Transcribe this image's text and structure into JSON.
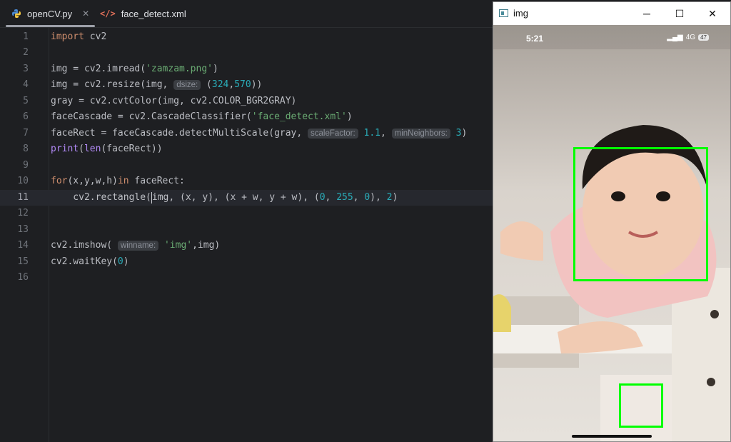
{
  "tabs": [
    {
      "label": "openCV.py",
      "active": true
    },
    {
      "label": "face_detect.xml",
      "active": false
    }
  ],
  "code_lines": [
    {
      "n": "1"
    },
    {
      "n": "2"
    },
    {
      "n": "3"
    },
    {
      "n": "4"
    },
    {
      "n": "5"
    },
    {
      "n": "6"
    },
    {
      "n": "7"
    },
    {
      "n": "8"
    },
    {
      "n": "9"
    },
    {
      "n": "10"
    },
    {
      "n": "11"
    },
    {
      "n": "12"
    },
    {
      "n": "13"
    },
    {
      "n": "14"
    },
    {
      "n": "15"
    },
    {
      "n": "16"
    }
  ],
  "code": {
    "l1": [
      "import",
      " cv2"
    ],
    "l3": [
      "img = cv2.imread(",
      "'zamzam.png'",
      ")"
    ],
    "l4": [
      "img = cv2.resize(img, ",
      "dsize:",
      " (",
      "324",
      ",",
      "570",
      "))"
    ],
    "l5": [
      "gray = cv2.cvtColor(img, cv2.COLOR_BGR2GRAY)"
    ],
    "l6": [
      "faceCascade = cv2.CascadeClassifier(",
      "'face_detect.xml'",
      ")"
    ],
    "l7": [
      "faceRect = faceCascade.detectMultiScale(gray, ",
      "scaleFactor:",
      " ",
      "1.1",
      ", ",
      "minNeighbors:",
      " ",
      "3",
      ")"
    ],
    "l8": [
      "print",
      "(",
      "len",
      "(faceRect))"
    ],
    "l10": [
      "for",
      "(x,y,w,h)",
      "in",
      " faceRect:"
    ],
    "l11": [
      "    cv2.rectangle(",
      "img, (x, y), (x + w, y + w), (",
      "0",
      ", ",
      "255",
      ", ",
      "0",
      "), ",
      "2",
      ")"
    ],
    "l14": [
      "cv2.imshow( ",
      "winname:",
      " ",
      "'img'",
      ",img)"
    ],
    "l15": [
      "cv2.waitKey(",
      "0",
      ")"
    ]
  },
  "image_window": {
    "title": "img",
    "minimize": "─",
    "maximize": "☐",
    "close": "✕",
    "status_time": "5:21",
    "status_network": "4G",
    "status_battery": "47"
  },
  "colors": {
    "box": "#00ff00",
    "keyword": "#cf8e6d",
    "string": "#6aab73",
    "number": "#2aacb8"
  }
}
